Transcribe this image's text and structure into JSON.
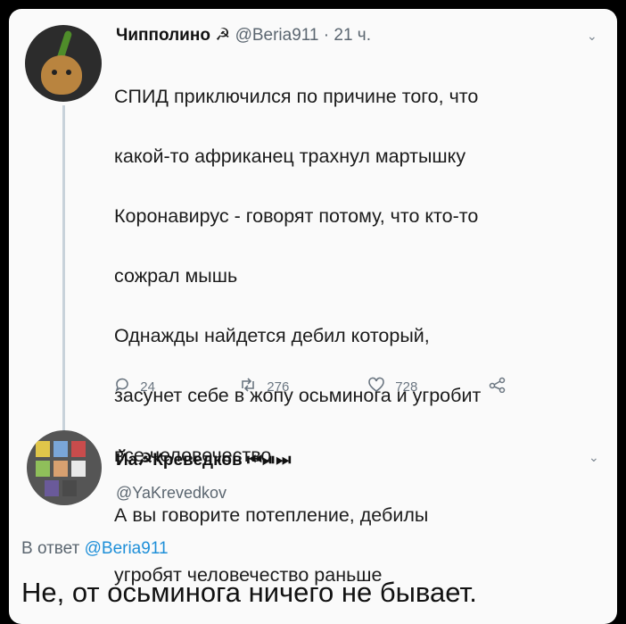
{
  "tweet": {
    "display_name": "Чипполино",
    "name_symbol": "☭",
    "handle": "@Beria911",
    "time": "· 21 ч.",
    "lines": [
      "СПИД приключился по причине того, что",
      "какой-то африканец трахнул мартышку",
      "Коронавирус - говорят потому, что кто-то",
      "сожрал мышь",
      "Однажды найдется дебил который,",
      "засунет себе в жопу осьминога и угробит",
      "все человечество",
      "А вы говорите потепление, дебилы",
      "угробят человечество раньше"
    ],
    "replies_count": "24",
    "retweets_count": "276",
    "likes_count": "728"
  },
  "reply": {
    "display_name": "Йа☭Креведков ⏮⏯⏭",
    "handle": "@YaKrevedkov",
    "reply_to_prefix": "В ответ",
    "reply_to_mention": "@Beria911",
    "text": "Не, от осьминога ничего не бывает."
  },
  "icons": {
    "reply": "comment-icon",
    "retweet": "retweet-icon",
    "like": "heart-icon",
    "share": "share-icon",
    "menu": "chevron-down-icon"
  },
  "colors": {
    "link": "#1e8fd8",
    "muted": "#5b6670",
    "background": "#fafafa"
  }
}
